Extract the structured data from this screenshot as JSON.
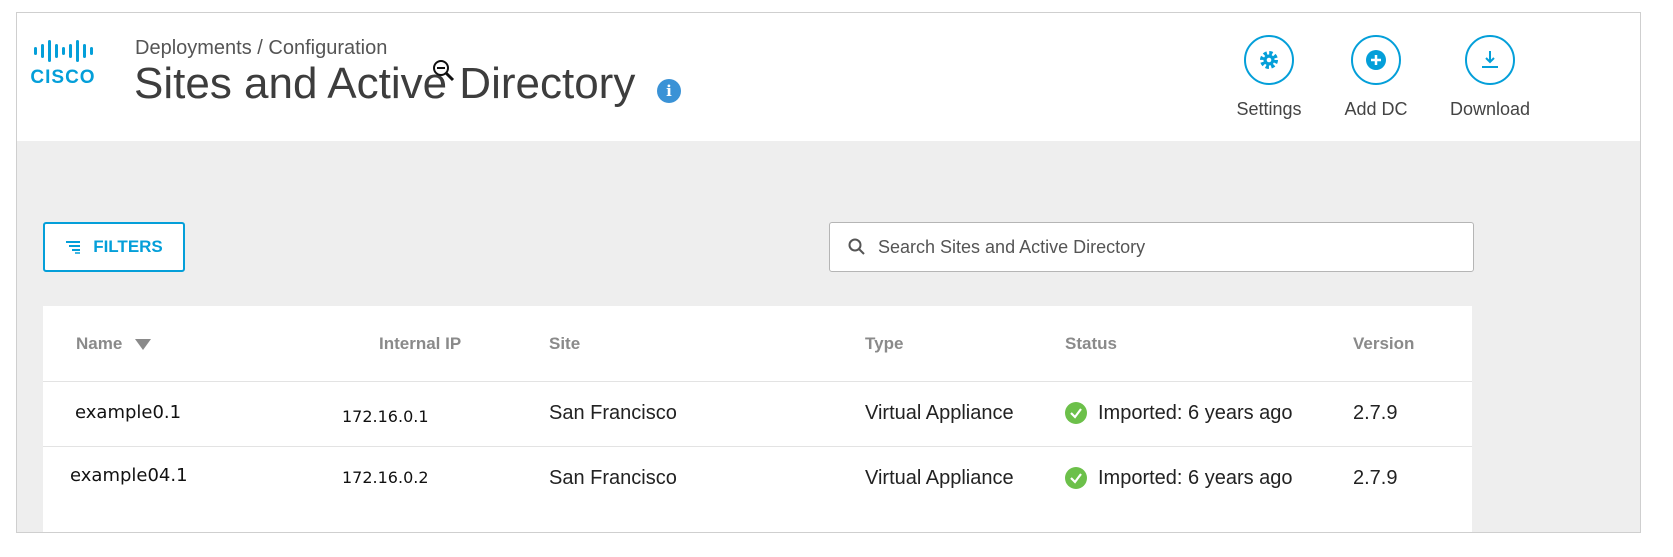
{
  "header": {
    "logo_text": "CISCO",
    "breadcrumb": "Deployments / Configuration",
    "title": "Sites and Active Directory",
    "info_glyph": "i",
    "actions": [
      {
        "label": "Settings",
        "icon": "gear-icon"
      },
      {
        "label": "Add DC",
        "icon": "plus-circle-icon"
      },
      {
        "label": "Download",
        "icon": "download-icon"
      }
    ]
  },
  "toolbar": {
    "filters_label": "FILTERS",
    "search_placeholder": "Search Sites and Active Directory",
    "search_value": ""
  },
  "table": {
    "columns": [
      "Name",
      "Internal IP",
      "Site",
      "Type",
      "Status",
      "Version"
    ],
    "sort_column": "Name",
    "rows": [
      {
        "name": "example0.1",
        "ip": "172.16.0.1",
        "site": "San Francisco",
        "type": "Virtual Appliance",
        "status": "Imported: 6 years ago",
        "version": "2.7.9"
      },
      {
        "name": "example04.1",
        "ip": "172.16.0.2",
        "site": "San Francisco",
        "type": "Virtual Appliance",
        "status": "Imported: 6 years ago",
        "version": "2.7.9"
      }
    ]
  },
  "colors": {
    "accent": "#049fd9",
    "status_ok": "#6cc04a",
    "info": "#3a92d6",
    "background": "#eeeeee"
  }
}
